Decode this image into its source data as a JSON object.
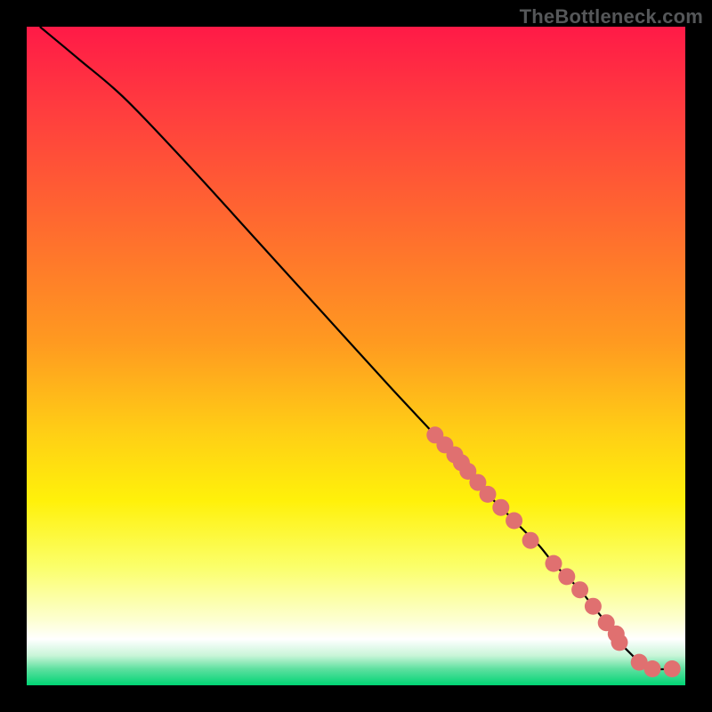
{
  "watermark": "TheBottleneck.com",
  "colors": {
    "frame": "#000000",
    "curve": "#000000",
    "marker_fill": "#e07070",
    "marker_stroke": "#000000",
    "gradient_stops": [
      {
        "offset": 0.0,
        "color": "#ff1a47"
      },
      {
        "offset": 0.12,
        "color": "#ff3b3f"
      },
      {
        "offset": 0.3,
        "color": "#ff6a2f"
      },
      {
        "offset": 0.48,
        "color": "#ff9a20"
      },
      {
        "offset": 0.62,
        "color": "#ffd015"
      },
      {
        "offset": 0.72,
        "color": "#fff10a"
      },
      {
        "offset": 0.82,
        "color": "#fbff6a"
      },
      {
        "offset": 0.9,
        "color": "#fdffd0"
      },
      {
        "offset": 0.93,
        "color": "#ffffff"
      },
      {
        "offset": 0.955,
        "color": "#c8f5d8"
      },
      {
        "offset": 0.975,
        "color": "#5fe0a0"
      },
      {
        "offset": 1.0,
        "color": "#00d474"
      }
    ]
  },
  "chart_data": {
    "type": "line",
    "title": "",
    "xlabel": "",
    "ylabel": "",
    "xlim": [
      0,
      100
    ],
    "ylim": [
      0,
      100
    ],
    "grid": false,
    "series": [
      {
        "name": "curve",
        "x": [
          2,
          8,
          15,
          25,
          35,
          45,
          55,
          62,
          67,
          70,
          72,
          74,
          76,
          78,
          80,
          82,
          84,
          86,
          88,
          89,
          90,
          91,
          92,
          93,
          95,
          98
        ],
        "y": [
          100,
          95,
          89,
          78.5,
          67.5,
          56.5,
          45.5,
          38,
          32.5,
          29,
          27,
          25,
          23,
          21,
          18.5,
          16.5,
          14.5,
          12,
          9.5,
          8,
          6.5,
          5.5,
          4.5,
          3.5,
          2.5,
          2.5
        ]
      }
    ],
    "scatter": {
      "name": "highlighted-points",
      "x": [
        62,
        63.5,
        65,
        66,
        67,
        68.5,
        70,
        72,
        74,
        76.5,
        80,
        82,
        84,
        86,
        88,
        89.5,
        90,
        93,
        95,
        98
      ],
      "y": [
        38,
        36.5,
        35,
        33.8,
        32.5,
        30.8,
        29,
        27,
        25,
        22,
        18.5,
        16.5,
        14.5,
        12,
        9.5,
        7.8,
        6.5,
        3.5,
        2.5,
        2.5
      ]
    }
  }
}
